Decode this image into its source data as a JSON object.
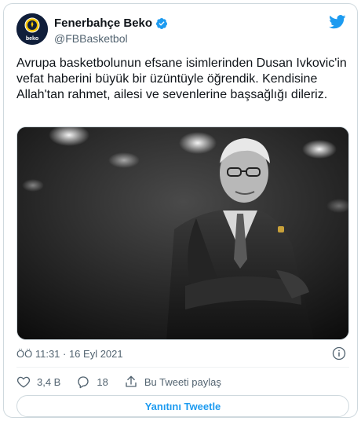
{
  "tweet": {
    "author_name": "Fenerbahçe Beko",
    "author_handle": "@FBBasketbol",
    "avatar_label": "beko",
    "text": "Avrupa basketbolunun efsane isimlerinden Dusan Ivkovic'in vefat haberini büyük bir üzüntüyle öğrendik. Kendisine Allah'tan rahmet, ailesi ve sevenlerine başsağlığı dileriz.",
    "timestamp": "ÖÖ 11:31 · 16 Eyl 2021"
  },
  "actions": {
    "likes": "3,4 B",
    "replies": "18",
    "share_label": "Bu Tweeti paylaş"
  },
  "reply_button": {
    "label": "Yanıtını Tweetle"
  },
  "icons": {
    "brand": "twitter-bird-icon",
    "verified": "verified-badge-icon",
    "info": "info-icon",
    "like": "heart-icon",
    "reply": "comment-icon",
    "share": "share-icon"
  },
  "colors": {
    "accent": "#1d9bf0",
    "text": "#0f1419",
    "secondary": "#536471",
    "border": "#cfd9de",
    "avatar_bg": "#101e3a",
    "logo_yellow": "#f5c400"
  }
}
